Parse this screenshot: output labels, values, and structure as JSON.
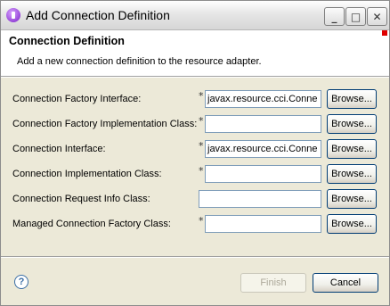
{
  "window": {
    "title": "Add Connection Definition"
  },
  "header": {
    "title": "Connection Definition",
    "description": "Add a new connection definition to the resource adapter."
  },
  "fields": [
    {
      "label": "Connection Factory Interface:",
      "required": "*",
      "value": "javax.resource.cci.Conne",
      "button": "Browse..."
    },
    {
      "label": "Connection Factory Implementation Class:",
      "required": "*",
      "value": "",
      "button": "Browse..."
    },
    {
      "label": "Connection Interface:",
      "required": "*",
      "value": "javax.resource.cci.Conne",
      "button": "Browse..."
    },
    {
      "label": "Connection Implementation Class:",
      "required": "*",
      "value": "",
      "button": "Browse..."
    },
    {
      "label": "Connection Request Info Class:",
      "required": "",
      "value": "",
      "button": "Browse..."
    },
    {
      "label": "Managed Connection Factory Class:",
      "required": "*",
      "value": "",
      "button": "Browse..."
    }
  ],
  "footer": {
    "help_label": "?",
    "finish_label": "Finish",
    "cancel_label": "Cancel"
  },
  "icons": {
    "app": "eclipse-purple-icon",
    "minimize": "minimize-icon",
    "maximize": "maximize-icon",
    "close": "close-icon",
    "help": "help-icon"
  }
}
